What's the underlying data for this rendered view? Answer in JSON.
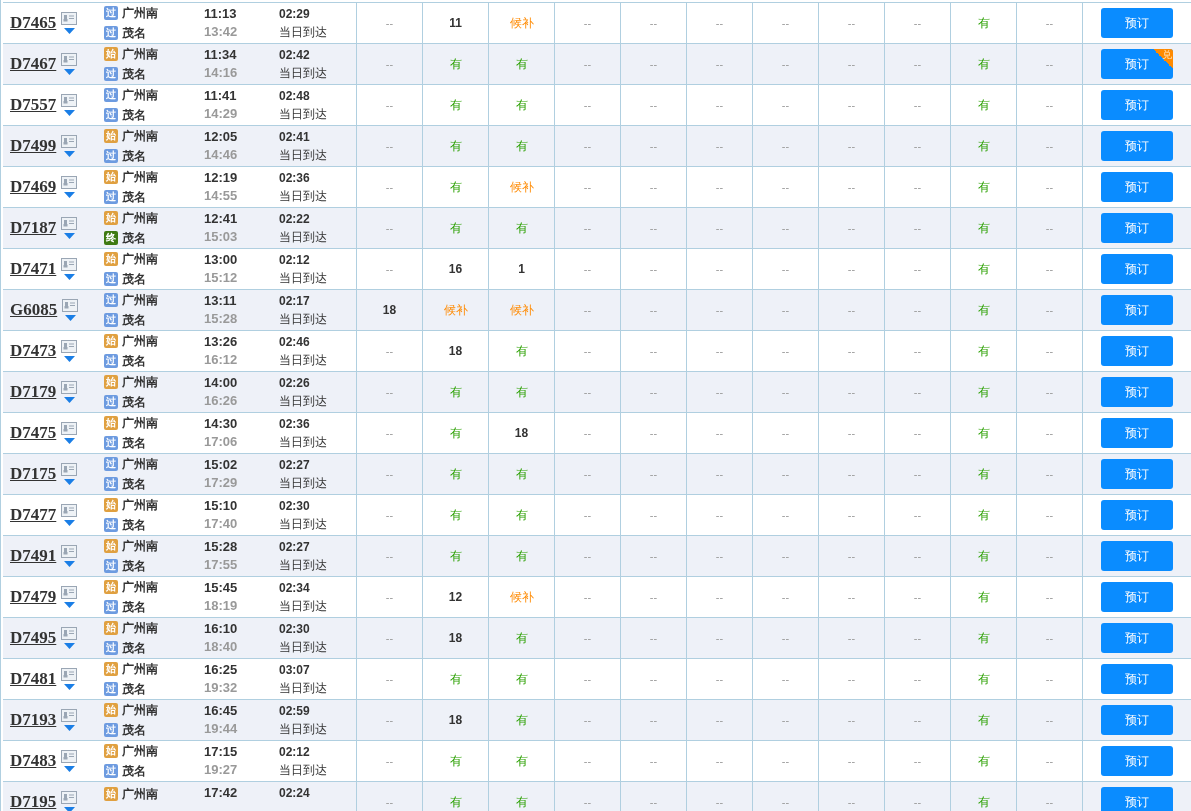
{
  "rows": [
    {
      "train": "D7465",
      "from": {
        "tag": "过",
        "kind": "pass"
      },
      "from_station": "广州南",
      "to": {
        "tag": "过",
        "kind": "pass"
      },
      "to_station": "茂名",
      "depart": "11:13",
      "arrive": "13:42",
      "duration": "02:29",
      "arrival_day": "当日到达",
      "seats": [
        {
          "text": "--",
          "kind": "none"
        },
        {
          "text": "11",
          "kind": "count"
        },
        {
          "text": "候补",
          "kind": "waitlist"
        },
        {
          "text": "--",
          "kind": "none"
        },
        {
          "text": "--",
          "kind": "none"
        },
        {
          "text": "--",
          "kind": "none"
        },
        {
          "text": "--",
          "kind": "none"
        },
        {
          "text": "--",
          "kind": "none"
        },
        {
          "text": "--",
          "kind": "none"
        },
        {
          "text": "有",
          "kind": "available"
        },
        {
          "text": "--",
          "kind": "none"
        }
      ],
      "button": "预订"
    },
    {
      "train": "D7467",
      "from": {
        "tag": "始",
        "kind": "start"
      },
      "from_station": "广州南",
      "to": {
        "tag": "过",
        "kind": "pass"
      },
      "to_station": "茂名",
      "depart": "11:34",
      "arrive": "14:16",
      "duration": "02:42",
      "arrival_day": "当日到达",
      "seats": [
        {
          "text": "--",
          "kind": "none"
        },
        {
          "text": "有",
          "kind": "available"
        },
        {
          "text": "有",
          "kind": "available"
        },
        {
          "text": "--",
          "kind": "none"
        },
        {
          "text": "--",
          "kind": "none"
        },
        {
          "text": "--",
          "kind": "none"
        },
        {
          "text": "--",
          "kind": "none"
        },
        {
          "text": "--",
          "kind": "none"
        },
        {
          "text": "--",
          "kind": "none"
        },
        {
          "text": "有",
          "kind": "available"
        },
        {
          "text": "--",
          "kind": "none"
        }
      ],
      "button": "预订",
      "button_badge": "兑"
    },
    {
      "train": "D7557",
      "from": {
        "tag": "过",
        "kind": "pass"
      },
      "from_station": "广州南",
      "to": {
        "tag": "过",
        "kind": "pass"
      },
      "to_station": "茂名",
      "depart": "11:41",
      "arrive": "14:29",
      "duration": "02:48",
      "arrival_day": "当日到达",
      "seats": [
        {
          "text": "--",
          "kind": "none"
        },
        {
          "text": "有",
          "kind": "available"
        },
        {
          "text": "有",
          "kind": "available"
        },
        {
          "text": "--",
          "kind": "none"
        },
        {
          "text": "--",
          "kind": "none"
        },
        {
          "text": "--",
          "kind": "none"
        },
        {
          "text": "--",
          "kind": "none"
        },
        {
          "text": "--",
          "kind": "none"
        },
        {
          "text": "--",
          "kind": "none"
        },
        {
          "text": "有",
          "kind": "available"
        },
        {
          "text": "--",
          "kind": "none"
        }
      ],
      "button": "预订"
    },
    {
      "train": "D7499",
      "from": {
        "tag": "始",
        "kind": "start"
      },
      "from_station": "广州南",
      "to": {
        "tag": "过",
        "kind": "pass"
      },
      "to_station": "茂名",
      "depart": "12:05",
      "arrive": "14:46",
      "duration": "02:41",
      "arrival_day": "当日到达",
      "seats": [
        {
          "text": "--",
          "kind": "none"
        },
        {
          "text": "有",
          "kind": "available"
        },
        {
          "text": "有",
          "kind": "available"
        },
        {
          "text": "--",
          "kind": "none"
        },
        {
          "text": "--",
          "kind": "none"
        },
        {
          "text": "--",
          "kind": "none"
        },
        {
          "text": "--",
          "kind": "none"
        },
        {
          "text": "--",
          "kind": "none"
        },
        {
          "text": "--",
          "kind": "none"
        },
        {
          "text": "有",
          "kind": "available"
        },
        {
          "text": "--",
          "kind": "none"
        }
      ],
      "button": "预订"
    },
    {
      "train": "D7469",
      "from": {
        "tag": "始",
        "kind": "start"
      },
      "from_station": "广州南",
      "to": {
        "tag": "过",
        "kind": "pass"
      },
      "to_station": "茂名",
      "depart": "12:19",
      "arrive": "14:55",
      "duration": "02:36",
      "arrival_day": "当日到达",
      "seats": [
        {
          "text": "--",
          "kind": "none"
        },
        {
          "text": "有",
          "kind": "available"
        },
        {
          "text": "候补",
          "kind": "waitlist"
        },
        {
          "text": "--",
          "kind": "none"
        },
        {
          "text": "--",
          "kind": "none"
        },
        {
          "text": "--",
          "kind": "none"
        },
        {
          "text": "--",
          "kind": "none"
        },
        {
          "text": "--",
          "kind": "none"
        },
        {
          "text": "--",
          "kind": "none"
        },
        {
          "text": "有",
          "kind": "available"
        },
        {
          "text": "--",
          "kind": "none"
        }
      ],
      "button": "预订"
    },
    {
      "train": "D7187",
      "from": {
        "tag": "始",
        "kind": "start"
      },
      "from_station": "广州南",
      "to": {
        "tag": "终",
        "kind": "end"
      },
      "to_station": "茂名",
      "depart": "12:41",
      "arrive": "15:03",
      "duration": "02:22",
      "arrival_day": "当日到达",
      "seats": [
        {
          "text": "--",
          "kind": "none"
        },
        {
          "text": "有",
          "kind": "available"
        },
        {
          "text": "有",
          "kind": "available"
        },
        {
          "text": "--",
          "kind": "none"
        },
        {
          "text": "--",
          "kind": "none"
        },
        {
          "text": "--",
          "kind": "none"
        },
        {
          "text": "--",
          "kind": "none"
        },
        {
          "text": "--",
          "kind": "none"
        },
        {
          "text": "--",
          "kind": "none"
        },
        {
          "text": "有",
          "kind": "available"
        },
        {
          "text": "--",
          "kind": "none"
        }
      ],
      "button": "预订"
    },
    {
      "train": "D7471",
      "from": {
        "tag": "始",
        "kind": "start"
      },
      "from_station": "广州南",
      "to": {
        "tag": "过",
        "kind": "pass"
      },
      "to_station": "茂名",
      "depart": "13:00",
      "arrive": "15:12",
      "duration": "02:12",
      "arrival_day": "当日到达",
      "seats": [
        {
          "text": "--",
          "kind": "none"
        },
        {
          "text": "16",
          "kind": "count"
        },
        {
          "text": "1",
          "kind": "count"
        },
        {
          "text": "--",
          "kind": "none"
        },
        {
          "text": "--",
          "kind": "none"
        },
        {
          "text": "--",
          "kind": "none"
        },
        {
          "text": "--",
          "kind": "none"
        },
        {
          "text": "--",
          "kind": "none"
        },
        {
          "text": "--",
          "kind": "none"
        },
        {
          "text": "有",
          "kind": "available"
        },
        {
          "text": "--",
          "kind": "none"
        }
      ],
      "button": "预订"
    },
    {
      "train": "G6085",
      "from": {
        "tag": "过",
        "kind": "pass"
      },
      "from_station": "广州南",
      "to": {
        "tag": "过",
        "kind": "pass"
      },
      "to_station": "茂名",
      "depart": "13:11",
      "arrive": "15:28",
      "duration": "02:17",
      "arrival_day": "当日到达",
      "seats": [
        {
          "text": "18",
          "kind": "count"
        },
        {
          "text": "候补",
          "kind": "waitlist"
        },
        {
          "text": "候补",
          "kind": "waitlist"
        },
        {
          "text": "--",
          "kind": "none"
        },
        {
          "text": "--",
          "kind": "none"
        },
        {
          "text": "--",
          "kind": "none"
        },
        {
          "text": "--",
          "kind": "none"
        },
        {
          "text": "--",
          "kind": "none"
        },
        {
          "text": "--",
          "kind": "none"
        },
        {
          "text": "有",
          "kind": "available"
        },
        {
          "text": "--",
          "kind": "none"
        }
      ],
      "button": "预订"
    },
    {
      "train": "D7473",
      "from": {
        "tag": "始",
        "kind": "start"
      },
      "from_station": "广州南",
      "to": {
        "tag": "过",
        "kind": "pass"
      },
      "to_station": "茂名",
      "depart": "13:26",
      "arrive": "16:12",
      "duration": "02:46",
      "arrival_day": "当日到达",
      "seats": [
        {
          "text": "--",
          "kind": "none"
        },
        {
          "text": "18",
          "kind": "count"
        },
        {
          "text": "有",
          "kind": "available"
        },
        {
          "text": "--",
          "kind": "none"
        },
        {
          "text": "--",
          "kind": "none"
        },
        {
          "text": "--",
          "kind": "none"
        },
        {
          "text": "--",
          "kind": "none"
        },
        {
          "text": "--",
          "kind": "none"
        },
        {
          "text": "--",
          "kind": "none"
        },
        {
          "text": "有",
          "kind": "available"
        },
        {
          "text": "--",
          "kind": "none"
        }
      ],
      "button": "预订"
    },
    {
      "train": "D7179",
      "from": {
        "tag": "始",
        "kind": "start"
      },
      "from_station": "广州南",
      "to": {
        "tag": "过",
        "kind": "pass"
      },
      "to_station": "茂名",
      "depart": "14:00",
      "arrive": "16:26",
      "duration": "02:26",
      "arrival_day": "当日到达",
      "seats": [
        {
          "text": "--",
          "kind": "none"
        },
        {
          "text": "有",
          "kind": "available"
        },
        {
          "text": "有",
          "kind": "available"
        },
        {
          "text": "--",
          "kind": "none"
        },
        {
          "text": "--",
          "kind": "none"
        },
        {
          "text": "--",
          "kind": "none"
        },
        {
          "text": "--",
          "kind": "none"
        },
        {
          "text": "--",
          "kind": "none"
        },
        {
          "text": "--",
          "kind": "none"
        },
        {
          "text": "有",
          "kind": "available"
        },
        {
          "text": "--",
          "kind": "none"
        }
      ],
      "button": "预订"
    },
    {
      "train": "D7475",
      "from": {
        "tag": "始",
        "kind": "start"
      },
      "from_station": "广州南",
      "to": {
        "tag": "过",
        "kind": "pass"
      },
      "to_station": "茂名",
      "depart": "14:30",
      "arrive": "17:06",
      "duration": "02:36",
      "arrival_day": "当日到达",
      "seats": [
        {
          "text": "--",
          "kind": "none"
        },
        {
          "text": "有",
          "kind": "available"
        },
        {
          "text": "18",
          "kind": "count"
        },
        {
          "text": "--",
          "kind": "none"
        },
        {
          "text": "--",
          "kind": "none"
        },
        {
          "text": "--",
          "kind": "none"
        },
        {
          "text": "--",
          "kind": "none"
        },
        {
          "text": "--",
          "kind": "none"
        },
        {
          "text": "--",
          "kind": "none"
        },
        {
          "text": "有",
          "kind": "available"
        },
        {
          "text": "--",
          "kind": "none"
        }
      ],
      "button": "预订"
    },
    {
      "train": "D7175",
      "from": {
        "tag": "过",
        "kind": "pass"
      },
      "from_station": "广州南",
      "to": {
        "tag": "过",
        "kind": "pass"
      },
      "to_station": "茂名",
      "depart": "15:02",
      "arrive": "17:29",
      "duration": "02:27",
      "arrival_day": "当日到达",
      "seats": [
        {
          "text": "--",
          "kind": "none"
        },
        {
          "text": "有",
          "kind": "available"
        },
        {
          "text": "有",
          "kind": "available"
        },
        {
          "text": "--",
          "kind": "none"
        },
        {
          "text": "--",
          "kind": "none"
        },
        {
          "text": "--",
          "kind": "none"
        },
        {
          "text": "--",
          "kind": "none"
        },
        {
          "text": "--",
          "kind": "none"
        },
        {
          "text": "--",
          "kind": "none"
        },
        {
          "text": "有",
          "kind": "available"
        },
        {
          "text": "--",
          "kind": "none"
        }
      ],
      "button": "预订"
    },
    {
      "train": "D7477",
      "from": {
        "tag": "始",
        "kind": "start"
      },
      "from_station": "广州南",
      "to": {
        "tag": "过",
        "kind": "pass"
      },
      "to_station": "茂名",
      "depart": "15:10",
      "arrive": "17:40",
      "duration": "02:30",
      "arrival_day": "当日到达",
      "seats": [
        {
          "text": "--",
          "kind": "none"
        },
        {
          "text": "有",
          "kind": "available"
        },
        {
          "text": "有",
          "kind": "available"
        },
        {
          "text": "--",
          "kind": "none"
        },
        {
          "text": "--",
          "kind": "none"
        },
        {
          "text": "--",
          "kind": "none"
        },
        {
          "text": "--",
          "kind": "none"
        },
        {
          "text": "--",
          "kind": "none"
        },
        {
          "text": "--",
          "kind": "none"
        },
        {
          "text": "有",
          "kind": "available"
        },
        {
          "text": "--",
          "kind": "none"
        }
      ],
      "button": "预订"
    },
    {
      "train": "D7491",
      "from": {
        "tag": "始",
        "kind": "start"
      },
      "from_station": "广州南",
      "to": {
        "tag": "过",
        "kind": "pass"
      },
      "to_station": "茂名",
      "depart": "15:28",
      "arrive": "17:55",
      "duration": "02:27",
      "arrival_day": "当日到达",
      "seats": [
        {
          "text": "--",
          "kind": "none"
        },
        {
          "text": "有",
          "kind": "available"
        },
        {
          "text": "有",
          "kind": "available"
        },
        {
          "text": "--",
          "kind": "none"
        },
        {
          "text": "--",
          "kind": "none"
        },
        {
          "text": "--",
          "kind": "none"
        },
        {
          "text": "--",
          "kind": "none"
        },
        {
          "text": "--",
          "kind": "none"
        },
        {
          "text": "--",
          "kind": "none"
        },
        {
          "text": "有",
          "kind": "available"
        },
        {
          "text": "--",
          "kind": "none"
        }
      ],
      "button": "预订"
    },
    {
      "train": "D7479",
      "from": {
        "tag": "始",
        "kind": "start"
      },
      "from_station": "广州南",
      "to": {
        "tag": "过",
        "kind": "pass"
      },
      "to_station": "茂名",
      "depart": "15:45",
      "arrive": "18:19",
      "duration": "02:34",
      "arrival_day": "当日到达",
      "seats": [
        {
          "text": "--",
          "kind": "none"
        },
        {
          "text": "12",
          "kind": "count"
        },
        {
          "text": "候补",
          "kind": "waitlist"
        },
        {
          "text": "--",
          "kind": "none"
        },
        {
          "text": "--",
          "kind": "none"
        },
        {
          "text": "--",
          "kind": "none"
        },
        {
          "text": "--",
          "kind": "none"
        },
        {
          "text": "--",
          "kind": "none"
        },
        {
          "text": "--",
          "kind": "none"
        },
        {
          "text": "有",
          "kind": "available"
        },
        {
          "text": "--",
          "kind": "none"
        }
      ],
      "button": "预订"
    },
    {
      "train": "D7495",
      "from": {
        "tag": "始",
        "kind": "start"
      },
      "from_station": "广州南",
      "to": {
        "tag": "过",
        "kind": "pass"
      },
      "to_station": "茂名",
      "depart": "16:10",
      "arrive": "18:40",
      "duration": "02:30",
      "arrival_day": "当日到达",
      "seats": [
        {
          "text": "--",
          "kind": "none"
        },
        {
          "text": "18",
          "kind": "count"
        },
        {
          "text": "有",
          "kind": "available"
        },
        {
          "text": "--",
          "kind": "none"
        },
        {
          "text": "--",
          "kind": "none"
        },
        {
          "text": "--",
          "kind": "none"
        },
        {
          "text": "--",
          "kind": "none"
        },
        {
          "text": "--",
          "kind": "none"
        },
        {
          "text": "--",
          "kind": "none"
        },
        {
          "text": "有",
          "kind": "available"
        },
        {
          "text": "--",
          "kind": "none"
        }
      ],
      "button": "预订"
    },
    {
      "train": "D7481",
      "from": {
        "tag": "始",
        "kind": "start"
      },
      "from_station": "广州南",
      "to": {
        "tag": "过",
        "kind": "pass"
      },
      "to_station": "茂名",
      "depart": "16:25",
      "arrive": "19:32",
      "duration": "03:07",
      "arrival_day": "当日到达",
      "seats": [
        {
          "text": "--",
          "kind": "none"
        },
        {
          "text": "有",
          "kind": "available"
        },
        {
          "text": "有",
          "kind": "available"
        },
        {
          "text": "--",
          "kind": "none"
        },
        {
          "text": "--",
          "kind": "none"
        },
        {
          "text": "--",
          "kind": "none"
        },
        {
          "text": "--",
          "kind": "none"
        },
        {
          "text": "--",
          "kind": "none"
        },
        {
          "text": "--",
          "kind": "none"
        },
        {
          "text": "有",
          "kind": "available"
        },
        {
          "text": "--",
          "kind": "none"
        }
      ],
      "button": "预订"
    },
    {
      "train": "D7193",
      "from": {
        "tag": "始",
        "kind": "start"
      },
      "from_station": "广州南",
      "to": {
        "tag": "过",
        "kind": "pass"
      },
      "to_station": "茂名",
      "depart": "16:45",
      "arrive": "19:44",
      "duration": "02:59",
      "arrival_day": "当日到达",
      "seats": [
        {
          "text": "--",
          "kind": "none"
        },
        {
          "text": "18",
          "kind": "count"
        },
        {
          "text": "有",
          "kind": "available"
        },
        {
          "text": "--",
          "kind": "none"
        },
        {
          "text": "--",
          "kind": "none"
        },
        {
          "text": "--",
          "kind": "none"
        },
        {
          "text": "--",
          "kind": "none"
        },
        {
          "text": "--",
          "kind": "none"
        },
        {
          "text": "--",
          "kind": "none"
        },
        {
          "text": "有",
          "kind": "available"
        },
        {
          "text": "--",
          "kind": "none"
        }
      ],
      "button": "预订"
    },
    {
      "train": "D7483",
      "from": {
        "tag": "始",
        "kind": "start"
      },
      "from_station": "广州南",
      "to": {
        "tag": "过",
        "kind": "pass"
      },
      "to_station": "茂名",
      "depart": "17:15",
      "arrive": "19:27",
      "duration": "02:12",
      "arrival_day": "当日到达",
      "seats": [
        {
          "text": "--",
          "kind": "none"
        },
        {
          "text": "有",
          "kind": "available"
        },
        {
          "text": "有",
          "kind": "available"
        },
        {
          "text": "--",
          "kind": "none"
        },
        {
          "text": "--",
          "kind": "none"
        },
        {
          "text": "--",
          "kind": "none"
        },
        {
          "text": "--",
          "kind": "none"
        },
        {
          "text": "--",
          "kind": "none"
        },
        {
          "text": "--",
          "kind": "none"
        },
        {
          "text": "有",
          "kind": "available"
        },
        {
          "text": "--",
          "kind": "none"
        }
      ],
      "button": "预订"
    },
    {
      "train": "D7195",
      "from": {
        "tag": "始",
        "kind": "start"
      },
      "from_station": "广州南",
      "depart": "17:42",
      "duration": "02:24",
      "seats": [
        {
          "text": "--",
          "kind": "none"
        },
        {
          "text": "有",
          "kind": "available"
        },
        {
          "text": "有",
          "kind": "available"
        },
        {
          "text": "--",
          "kind": "none"
        },
        {
          "text": "--",
          "kind": "none"
        },
        {
          "text": "--",
          "kind": "none"
        },
        {
          "text": "--",
          "kind": "none"
        },
        {
          "text": "--",
          "kind": "none"
        },
        {
          "text": "--",
          "kind": "none"
        },
        {
          "text": "有",
          "kind": "available"
        },
        {
          "text": "--",
          "kind": "none"
        }
      ],
      "button": "预订"
    }
  ]
}
